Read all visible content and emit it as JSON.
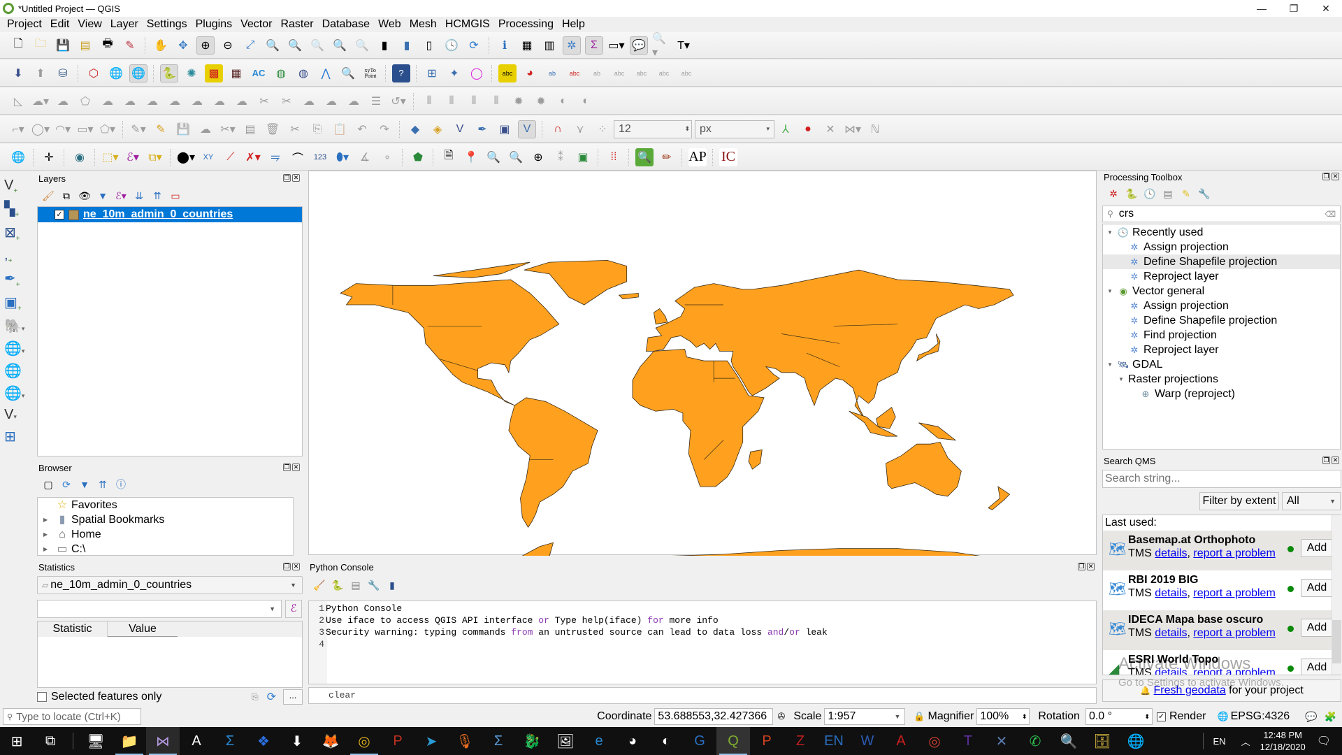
{
  "window": {
    "title": "*Untitled Project — QGIS",
    "controls": {
      "minimize": "—",
      "maximize": "❐",
      "close": "✕"
    }
  },
  "menu": [
    "Project",
    "Edit",
    "View",
    "Layer",
    "Settings",
    "Plugins",
    "Vector",
    "Raster",
    "Database",
    "Web",
    "Mesh",
    "HCMGIS",
    "Processing",
    "Help"
  ],
  "toolbars": {
    "row1": [
      "new-project",
      "open-project",
      "save-project",
      "save-as",
      "print-layout",
      "style-manager",
      "pan",
      "pan-to-selection",
      "zoom-in",
      "zoom-out",
      "zoom-full",
      "zoom-to-selection",
      "zoom-to-layer",
      "zoom-native",
      "zoom-last",
      "zoom-next",
      "new-bookmark",
      "show-bookmarks",
      "new-map-view",
      "temporal-controller",
      "refresh",
      "identify",
      "attribute-table",
      "field-calculator",
      "processing-toolbox",
      "statistics-summary",
      "measure",
      "map-tips",
      "select-by-location",
      "text-annotation"
    ],
    "row2": [
      "install-plugin",
      "upload",
      "database",
      "shape-tools",
      "qms-add",
      "qms-search",
      "python-console",
      "georef",
      "mosaic",
      "grid",
      "ac-tool",
      "network-up",
      "network-down",
      "routing",
      "query-layer",
      "xy-to-point",
      "help",
      "coord-capture",
      "vertex",
      "circle-tool",
      "label-abc",
      "diagram",
      "label-pin",
      "label-show"
    ],
    "row3": [
      "digitize-tools-disabled"
    ],
    "row4": {
      "font_size_value": "12",
      "unit_value": "px"
    },
    "row5": {
      "ap_label": "AP",
      "ic_label": "IC",
      "counter_label": "123"
    }
  },
  "layers_panel": {
    "title": "Layers",
    "layers": [
      {
        "name": "ne_10m_admin_0_countries",
        "checked": true,
        "color": "#b59556",
        "selected": true
      }
    ]
  },
  "browser_panel": {
    "title": "Browser",
    "items": [
      {
        "label": "Favorites",
        "icon": "star-icon",
        "expandable": false
      },
      {
        "label": "Spatial Bookmarks",
        "icon": "bookmark-icon",
        "expandable": true
      },
      {
        "label": "Home",
        "icon": "home-icon",
        "expandable": true
      },
      {
        "label": "C:\\",
        "icon": "folder-icon",
        "expandable": true
      }
    ]
  },
  "statistics_panel": {
    "title": "Statistics",
    "layer_value": "ne_10m_admin_0_countries",
    "field_value": "",
    "columns": [
      "Statistic",
      "Value"
    ],
    "selected_only_label": "Selected features only",
    "selected_only_checked": false,
    "more_label": "..."
  },
  "python_console": {
    "title": "Python Console",
    "lines": [
      {
        "n": "1",
        "text": "Python Console"
      },
      {
        "n": "2",
        "parts": [
          "Use iface to access QGIS API interface ",
          "or",
          " Type help(iface) ",
          "for",
          " more info"
        ]
      },
      {
        "n": "3",
        "parts": [
          "Security warning: typing commands ",
          "from",
          " an untrusted source can lead to data loss ",
          "and",
          "/",
          "or",
          " leak"
        ]
      },
      {
        "n": "4",
        "text": ""
      }
    ],
    "input_value": "clear"
  },
  "map": {
    "fill_color": "#ffa11f",
    "stroke_color": "#3a2a14",
    "background": "#ffffff"
  },
  "processing_toolbox": {
    "title": "Processing Toolbox",
    "search_value": "crs",
    "groups": [
      {
        "label": "Recently used",
        "icon": "clock-icon",
        "items": [
          "Assign projection",
          "Define Shapefile projection",
          "Reproject layer"
        ]
      },
      {
        "label": "Vector general",
        "icon": "qgis-icon",
        "items": [
          "Assign projection",
          "Define Shapefile projection",
          "Find projection",
          "Reproject layer"
        ]
      },
      {
        "label": "GDAL",
        "icon": "gdal-icon",
        "subgroups": [
          {
            "label": "Raster projections",
            "items": [
              "Warp (reproject)"
            ]
          }
        ]
      }
    ],
    "highlighted_item": "Define Shapefile projection"
  },
  "qms_panel": {
    "title": "Search QMS",
    "search_placeholder": "Search string...",
    "filter_label": "Filter by extent",
    "filter_select": "All",
    "last_used_label": "Last used:",
    "services": [
      {
        "name": "Basemap.at Orthophoto",
        "type": "TMS",
        "details": "details",
        "report": "report a problem",
        "status": "online",
        "add": "Add"
      },
      {
        "name": "RBI 2019 BIG",
        "type": "TMS",
        "details": "details",
        "report": "report a problem",
        "status": "online",
        "add": "Add"
      },
      {
        "name": "IDECA Mapa base oscuro",
        "type": "TMS",
        "details": "details",
        "report": "report a problem",
        "status": "online",
        "add": "Add"
      },
      {
        "name": "ESRI World Topo",
        "type": "TMS",
        "details": "details",
        "report": "report a problem",
        "status": "online",
        "add": "Add"
      }
    ],
    "footer_link": "Fresh geodata",
    "footer_text": " for your project",
    "watermark_line1": "Activate Windows",
    "watermark_line2": "Go to Settings to activate Windows."
  },
  "statusbar": {
    "locator_placeholder": "Type to locate (Ctrl+K)",
    "coordinate_label": "Coordinate",
    "coordinate_value": "53.688553,32.427366",
    "scale_label": "Scale",
    "scale_value": "1:957",
    "magnifier_label": "Magnifier",
    "magnifier_value": "100%",
    "rotation_label": "Rotation",
    "rotation_value": "0.0 °",
    "render_label": "Render",
    "render_checked": true,
    "crs_label": "EPSG:4326"
  },
  "taskbar": {
    "apps": [
      "start",
      "task-view",
      "this-pc",
      "file-explorer",
      "visual-studio",
      "typing-app",
      "sigma",
      "dropbox",
      "idm",
      "firefox",
      "chrome",
      "psiphon",
      "telegram",
      "recorder",
      "math-app",
      "image-app",
      "paint",
      "ie",
      "color-app",
      "earth-pro",
      "geogebra",
      "qgis",
      "powerpoint",
      "winzip",
      "endnote",
      "word",
      "autocad",
      "spiral-app",
      "texmaker",
      "app-x",
      "whatsapp",
      "search-app",
      "cabinet",
      "globe-app"
    ],
    "language": "EN",
    "time": "12:48 PM",
    "date": "12/18/2020"
  }
}
